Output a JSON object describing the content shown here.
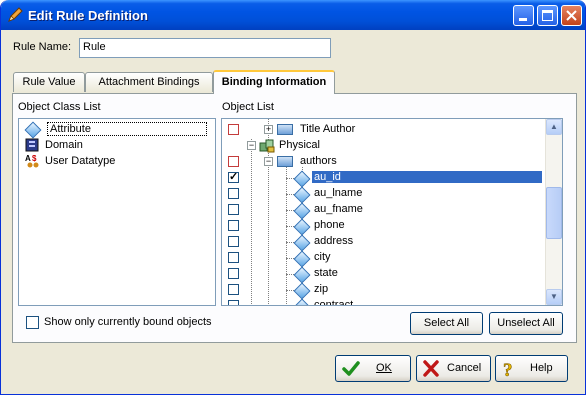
{
  "window": {
    "title": "Edit Rule Definition"
  },
  "rule_name": {
    "label": "Rule Name:",
    "value": "Rule"
  },
  "tabs": [
    {
      "label": "Rule Value"
    },
    {
      "label": "Attachment Bindings"
    },
    {
      "label": "Binding Information"
    }
  ],
  "object_class_list": {
    "label": "Object Class List",
    "items": [
      {
        "label": "Attribute",
        "icon": "attribute-icon"
      },
      {
        "label": "Domain",
        "icon": "domain-icon"
      },
      {
        "label": "User Datatype",
        "icon": "user-datatype-icon"
      }
    ]
  },
  "object_list": {
    "label": "Object List",
    "items": [
      {
        "label": "Title Author",
        "checked": false
      },
      {
        "label": "Physical"
      },
      {
        "label": "authors",
        "checked": false
      },
      {
        "label": "au_id",
        "checked": true
      },
      {
        "label": "au_lname",
        "checked": false
      },
      {
        "label": "au_fname",
        "checked": false
      },
      {
        "label": "phone",
        "checked": false
      },
      {
        "label": "address",
        "checked": false
      },
      {
        "label": "city",
        "checked": false
      },
      {
        "label": "state",
        "checked": false
      },
      {
        "label": "zip",
        "checked": false
      },
      {
        "label": "contract",
        "checked": false
      }
    ]
  },
  "show_bound": {
    "label": "Show only currently bound objects",
    "checked": false
  },
  "buttons": {
    "select_all": "Select All",
    "unselect_all": "Unselect All",
    "ok": "OK",
    "cancel": "Cancel",
    "help": "Help"
  }
}
